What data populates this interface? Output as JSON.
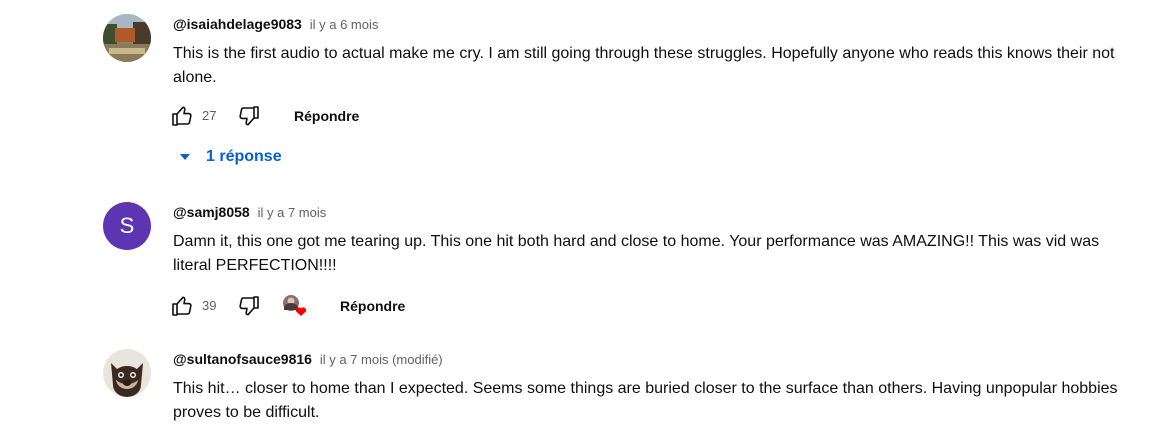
{
  "comments": [
    {
      "author": "@isaiahdelage9083",
      "time": "il y a 6 mois",
      "text": "This is the first audio to actual make me cry. I am still going through these struggles. Hopefully anyone who reads this knows their not alone.",
      "likes": "27",
      "reply_label": "Répondre",
      "replies_toggle": "1 réponse",
      "avatar": "landscape-photo"
    },
    {
      "author": "@samj8058",
      "time": "il y a 7 mois",
      "text": "Damn it, this one got me tearing up. This one hit both hard and close to home. Your performance was AMAZING!! This was vid was literal PERFECTION!!!!",
      "likes": "39",
      "reply_label": "Répondre",
      "avatar_letter": "S",
      "avatar_color": "#5e35b1",
      "creator_heart": true
    },
    {
      "author": "@sultanofsauce9816",
      "time": "il y a 7 mois (modifié)",
      "text": "This hit… closer to home than I expected. Seems some things are buried closer to the surface than others. Having unpopular hobbies proves to be difficult.",
      "avatar": "cat-photo"
    }
  ],
  "icons": {
    "like": "thumb-up-icon",
    "dislike": "thumb-down-icon",
    "expand": "caret-down-icon",
    "heart": "creator-heart-icon"
  },
  "colors": {
    "link_blue": "#065fd4",
    "meta_gray": "#606060",
    "heart_red": "#ff0000"
  }
}
